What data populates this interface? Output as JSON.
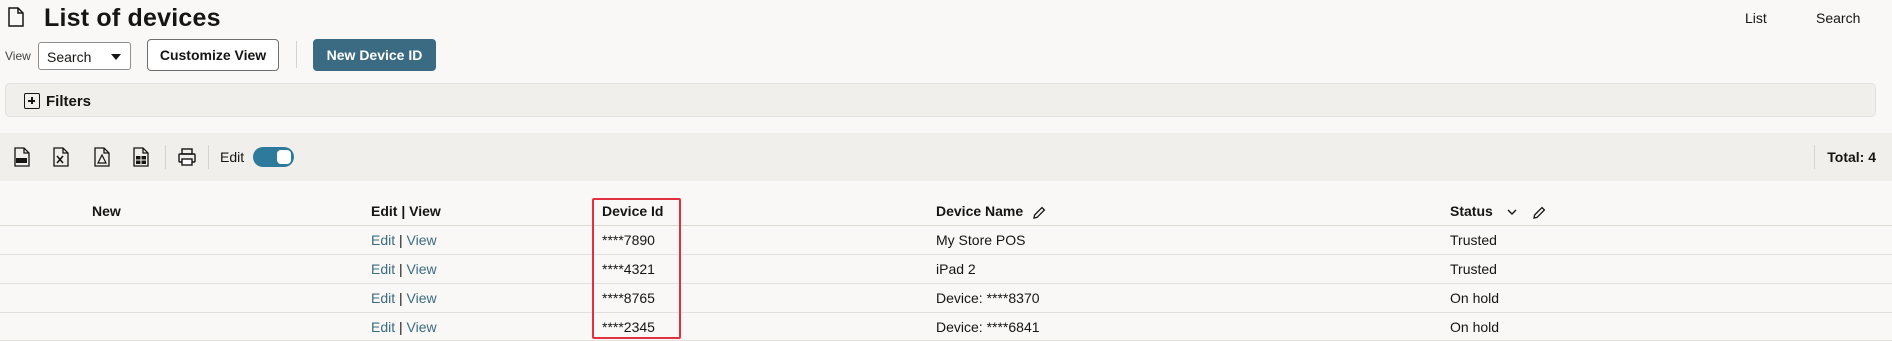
{
  "header": {
    "title": "List of devices",
    "links": [
      "List",
      "Search"
    ]
  },
  "view_row": {
    "view_label": "View",
    "view_select_value": "Search",
    "customize_button": "Customize View",
    "new_device_button": "New Device ID"
  },
  "filters": {
    "label": "Filters"
  },
  "toolbar": {
    "icons": [
      "csv-export-icon",
      "excel-export-icon",
      "pdf-export-icon",
      "spreadsheet-export-icon",
      "print-icon"
    ],
    "edit_label": "Edit",
    "edit_toggle_on": true,
    "total": "Total: 4"
  },
  "table": {
    "headers": {
      "new": "New",
      "edit_view": "Edit | View",
      "device_id": "Device Id",
      "device_name": "Device Name",
      "status": "Status"
    },
    "rows": [
      {
        "edit": "Edit",
        "sep": "|",
        "view": "View",
        "device_id": "****7890",
        "device_name": "My Store POS",
        "status": "Trusted"
      },
      {
        "edit": "Edit",
        "sep": "|",
        "view": "View",
        "device_id": "****4321",
        "device_name": "iPad 2",
        "status": "Trusted"
      },
      {
        "edit": "Edit",
        "sep": "|",
        "view": "View",
        "device_id": "****8765",
        "device_name": "Device: ****8370",
        "status": "On hold"
      },
      {
        "edit": "Edit",
        "sep": "|",
        "view": "View",
        "device_id": "****2345",
        "device_name": "Device: ****6841",
        "status": "On hold"
      }
    ]
  },
  "colors": {
    "primary_button": "#3b6b82",
    "link": "#3b6b82",
    "toggle_on": "#2e7a9c",
    "highlight_box": "#e0323e"
  }
}
